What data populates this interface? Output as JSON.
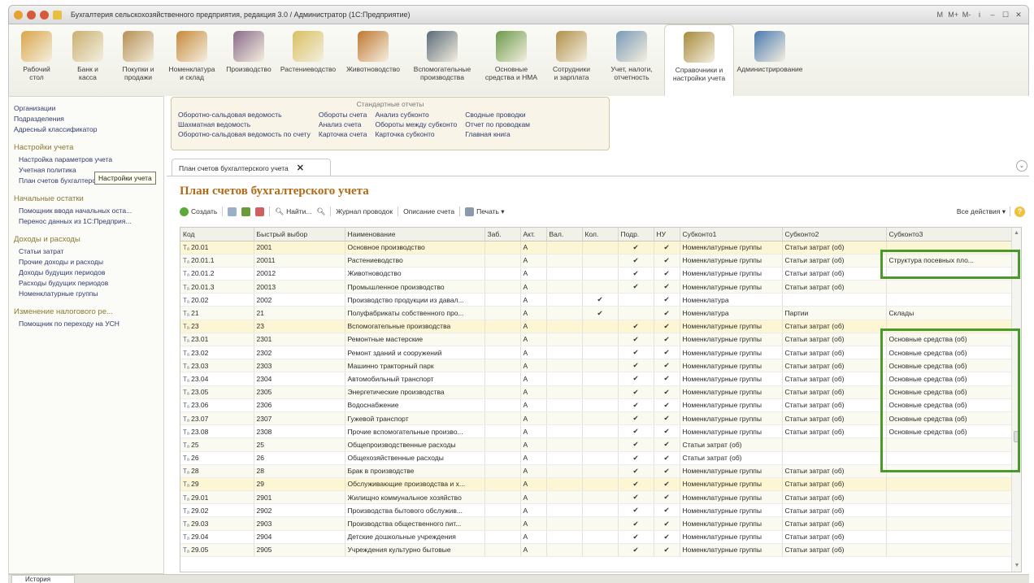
{
  "window": {
    "title": "Бухгалтерия сельскохозяйственного предприятия, редакция 3.0 / Администратор  (1С:Предприятие)",
    "right_controls": [
      "M",
      "M+",
      "M-",
      "i",
      "–",
      "☐",
      "✕"
    ]
  },
  "sections": [
    {
      "label": "Рабочий\nстол",
      "icon": "desk-icon",
      "color": "#d9a64a"
    },
    {
      "label": "Банк и\nкасса",
      "icon": "bank-icon",
      "color": "#c9b070"
    },
    {
      "label": "Покупки и\nпродажи",
      "icon": "truck-icon",
      "color": "#b69055"
    },
    {
      "label": "Номенклатура\nи склад",
      "icon": "warehouse-icon",
      "color": "#c68a3a"
    },
    {
      "label": "Производство",
      "icon": "factory-icon",
      "color": "#8a6a8a"
    },
    {
      "label": "Растениеводство",
      "icon": "wheat-icon",
      "color": "#d8c060"
    },
    {
      "label": "Животноводство",
      "icon": "cow-icon",
      "color": "#c07830"
    },
    {
      "label": "Вспомогательные\nпроизводства",
      "icon": "tractor-icon",
      "color": "#5a6a7a"
    },
    {
      "label": "Основные\nсредства и НМА",
      "icon": "fixed-assets-icon",
      "color": "#6a9a4a"
    },
    {
      "label": "Сотрудники\nи зарплата",
      "icon": "employees-icon",
      "color": "#b0904a"
    },
    {
      "label": "Учет, налоги,\nотчетность",
      "icon": "tax-icon",
      "color": "#7a9ab8"
    },
    {
      "label": "Справочники и\nнастройки учета",
      "icon": "books-icon",
      "color": "#a88a3a",
      "active": true
    },
    {
      "label": "Администрирование",
      "icon": "admin-icon",
      "color": "#4a7ab0"
    }
  ],
  "left_panel": {
    "top_items": [
      "Организации",
      "Подразделения",
      "Адресный классификатор"
    ],
    "groups": [
      {
        "title": "Настройки учета",
        "items": [
          "Настройка параметров учета",
          "Учетная политика",
          "План счетов бухгалтерского учета"
        ]
      },
      {
        "title": "Начальные остатки",
        "items": [
          "Помощник ввода начальных оста...",
          "Перенос данных из 1С:Предприя..."
        ]
      },
      {
        "title": "Доходы и расходы",
        "items": [
          "Статьи затрат",
          "Прочие доходы и расходы",
          "Доходы будущих периодов",
          "Расходы будущих периодов",
          "Номенклатурные группы"
        ]
      },
      {
        "title": "Изменение налогового ре...",
        "items": [
          "Помощник по переходу на УСН"
        ]
      }
    ],
    "tooltip": "Настройки учета"
  },
  "reports": {
    "title": "Стандартные отчеты",
    "columns": [
      [
        "Оборотно-сальдовая ведомость",
        "Шахматная ведомость",
        "Оборотно-сальдовая ведомость по счету"
      ],
      [
        "Обороты счета",
        "Анализ счета",
        "Карточка счета"
      ],
      [
        "Анализ субконто",
        "Обороты между субконто",
        "Карточка субконто"
      ],
      [
        "Сводные проводки",
        "Отчет по проводкам",
        "Главная книга"
      ]
    ]
  },
  "tab": {
    "label": "План счетов бухгалтерского учета",
    "close": "✕"
  },
  "page_title": "План счетов бухгалтерского учета",
  "toolbar": {
    "create": "Создать",
    "find": "Найти...",
    "journal": "Журнал проводок",
    "description": "Описание счета",
    "print": "Печать ▾",
    "all_actions": "Все действия ▾",
    "help": "?"
  },
  "table": {
    "columns": [
      "Код",
      "Быстрый выбор",
      "Наименование",
      "Заб.",
      "Акт.",
      "Вал.",
      "Кол.",
      "Подр.",
      "НУ",
      "Субконто1",
      "Субконто2",
      "Субконто3"
    ],
    "rows": [
      [
        "20.01",
        "2001",
        "Основное производство",
        "",
        "А",
        "",
        "",
        "✔",
        "✔",
        "Номенклатурные группы",
        "Статьи затрат (об)",
        ""
      ],
      [
        "20.01.1",
        "20011",
        "Растениеводство",
        "",
        "А",
        "",
        "",
        "✔",
        "✔",
        "Номенклатурные группы",
        "Статьи затрат (об)",
        "Структура посевных пло..."
      ],
      [
        "20.01.2",
        "20012",
        "Животноводство",
        "",
        "А",
        "",
        "",
        "✔",
        "✔",
        "Номенклатурные группы",
        "Статьи затрат (об)",
        ""
      ],
      [
        "20.01.3",
        "20013",
        "Промышленное производство",
        "",
        "А",
        "",
        "",
        "✔",
        "✔",
        "Номенклатурные группы",
        "Статьи затрат (об)",
        ""
      ],
      [
        "20.02",
        "2002",
        "Производство продукции из давал...",
        "",
        "А",
        "",
        "✔",
        "",
        "✔",
        "Номенклатура",
        "",
        ""
      ],
      [
        "21",
        "21",
        "Полуфабрикаты собственного про...",
        "",
        "А",
        "",
        "✔",
        "",
        "✔",
        "Номенклатура",
        "Партии",
        "Склады"
      ],
      [
        "23",
        "23",
        "Вспомогательные производства",
        "",
        "А",
        "",
        "",
        "✔",
        "✔",
        "Номенклатурные группы",
        "Статьи затрат (об)",
        ""
      ],
      [
        "23.01",
        "2301",
        "Ремонтные мастерские",
        "",
        "А",
        "",
        "",
        "✔",
        "✔",
        "Номенклатурные группы",
        "Статьи затрат (об)",
        "Основные средства (об)"
      ],
      [
        "23.02",
        "2302",
        "Ремонт зданий и сооружений",
        "",
        "А",
        "",
        "",
        "✔",
        "✔",
        "Номенклатурные группы",
        "Статьи затрат (об)",
        "Основные средства (об)"
      ],
      [
        "23.03",
        "2303",
        "Машинно тракторный парк",
        "",
        "А",
        "",
        "",
        "✔",
        "✔",
        "Номенклатурные группы",
        "Статьи затрат (об)",
        "Основные средства (об)"
      ],
      [
        "23.04",
        "2304",
        "Автомобильный транспорт",
        "",
        "А",
        "",
        "",
        "✔",
        "✔",
        "Номенклатурные группы",
        "Статьи затрат (об)",
        "Основные средства (об)"
      ],
      [
        "23.05",
        "2305",
        "Энергетические производства",
        "",
        "А",
        "",
        "",
        "✔",
        "✔",
        "Номенклатурные группы",
        "Статьи затрат (об)",
        "Основные средства (об)"
      ],
      [
        "23.06",
        "2306",
        "Водоснабжение",
        "",
        "А",
        "",
        "",
        "✔",
        "✔",
        "Номенклатурные группы",
        "Статьи затрат (об)",
        "Основные средства (об)"
      ],
      [
        "23.07",
        "2307",
        "Гужевой транспорт",
        "",
        "А",
        "",
        "",
        "✔",
        "✔",
        "Номенклатурные группы",
        "Статьи затрат (об)",
        "Основные средства (об)"
      ],
      [
        "23.08",
        "2308",
        "Прочие вспомогательные произво...",
        "",
        "А",
        "",
        "",
        "✔",
        "✔",
        "Номенклатурные группы",
        "Статьи затрат (об)",
        "Основные средства (об)"
      ],
      [
        "25",
        "25",
        "Общепроизводственные расходы",
        "",
        "А",
        "",
        "",
        "✔",
        "✔",
        "Статьи затрат (об)",
        "",
        ""
      ],
      [
        "26",
        "26",
        "Общехозяйственные расходы",
        "",
        "А",
        "",
        "",
        "✔",
        "✔",
        "Статьи затрат (об)",
        "",
        ""
      ],
      [
        "28",
        "28",
        "Брак в производстве",
        "",
        "А",
        "",
        "",
        "✔",
        "✔",
        "Номенклатурные группы",
        "Статьи затрат (об)",
        ""
      ],
      [
        "29",
        "29",
        "Обслуживающие производства и х...",
        "",
        "А",
        "",
        "",
        "✔",
        "✔",
        "Номенклатурные группы",
        "Статьи затрат (об)",
        ""
      ],
      [
        "29.01",
        "2901",
        "Жилищно коммунальное хозяйство",
        "",
        "А",
        "",
        "",
        "✔",
        "✔",
        "Номенклатурные группы",
        "Статьи затрат (об)",
        ""
      ],
      [
        "29.02",
        "2902",
        "Производства бытового обслужив...",
        "",
        "А",
        "",
        "",
        "✔",
        "✔",
        "Номенклатурные группы",
        "Статьи затрат (об)",
        ""
      ],
      [
        "29.03",
        "2903",
        "Производства общественного пит...",
        "",
        "А",
        "",
        "",
        "✔",
        "✔",
        "Номенклатурные группы",
        "Статьи затрат (об)",
        ""
      ],
      [
        "29.04",
        "2904",
        "Детские дошкольные учреждения",
        "",
        "А",
        "",
        "",
        "✔",
        "✔",
        "Номенклатурные группы",
        "Статьи затрат (об)",
        ""
      ],
      [
        "29.05",
        "2905",
        "Учреждения культурно бытовые",
        "",
        "А",
        "",
        "",
        "✔",
        "✔",
        "Номенклатурные группы",
        "Статьи затрат (об)",
        ""
      ]
    ],
    "highlight_rows": [
      0,
      6,
      18
    ]
  },
  "bottom": {
    "history": "История"
  },
  "colors": {
    "highlight_box": "#4a9a2a",
    "title": "#b06a17",
    "group_head": "#8a7a30"
  }
}
